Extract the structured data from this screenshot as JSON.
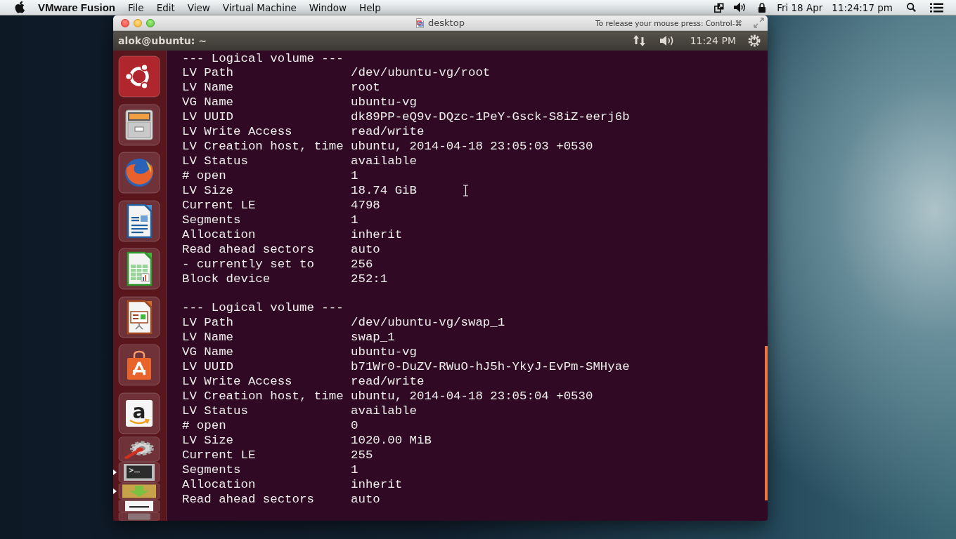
{
  "menu_bar": {
    "app_name": "VMware Fusion",
    "menus": [
      "File",
      "Edit",
      "View",
      "Virtual Machine",
      "Window",
      "Help"
    ],
    "date": "Fri 18 Apr",
    "time": "11:24:17 pm"
  },
  "vm_window": {
    "title": "desktop",
    "mouse_hint": "To release your mouse press: Control-⌘"
  },
  "top_panel": {
    "title": "alok@ubuntu: ~",
    "clock": "11:24 PM"
  },
  "launcher": {
    "items": [
      {
        "kind": "home",
        "running": false,
        "folded": false
      },
      {
        "kind": "files",
        "running": false,
        "folded": false
      },
      {
        "kind": "browser",
        "running": false,
        "folded": false
      },
      {
        "kind": "writer",
        "running": false,
        "folded": false
      },
      {
        "kind": "calc",
        "running": false,
        "folded": false
      },
      {
        "kind": "impress",
        "running": false,
        "folded": false
      },
      {
        "kind": "software",
        "running": false,
        "folded": false
      },
      {
        "kind": "store",
        "glyph": "a",
        "running": false,
        "folded": false
      },
      {
        "kind": "settings",
        "running": false,
        "folded": true
      },
      {
        "kind": "terminal",
        "running": true,
        "folded": true
      },
      {
        "kind": "downloads",
        "running": true,
        "folded": true
      },
      {
        "kind": "document",
        "running": false,
        "folded": true
      },
      {
        "kind": "trash",
        "running": false,
        "folded": true
      }
    ]
  },
  "terminal": {
    "blocks": [
      {
        "header": "--- Logical volume ---",
        "rows": [
          {
            "label": "LV Path",
            "value": "/dev/ubuntu-vg/root"
          },
          {
            "label": "LV Name",
            "value": "root"
          },
          {
            "label": "VG Name",
            "value": "ubuntu-vg"
          },
          {
            "label": "LV UUID",
            "value": "dk89PP-eQ9v-DQzc-1PeY-Gsck-S8iZ-eerj6b"
          },
          {
            "label": "LV Write Access",
            "value": "read/write"
          },
          {
            "label": "LV Creation host, time",
            "value": "ubuntu, 2014-04-18 23:05:03 +0530"
          },
          {
            "label": "LV Status",
            "value": "available"
          },
          {
            "label": "# open",
            "value": "1"
          },
          {
            "label": "LV Size",
            "value": "18.74 GiB"
          },
          {
            "label": "Current LE",
            "value": "4798"
          },
          {
            "label": "Segments",
            "value": "1"
          },
          {
            "label": "Allocation",
            "value": "inherit"
          },
          {
            "label": "Read ahead sectors",
            "value": "auto"
          },
          {
            "label": "- currently set to",
            "value": "256"
          },
          {
            "label": "Block device",
            "value": "252:1"
          }
        ]
      },
      {
        "header": "--- Logical volume ---",
        "rows": [
          {
            "label": "LV Path",
            "value": "/dev/ubuntu-vg/swap_1"
          },
          {
            "label": "LV Name",
            "value": "swap_1"
          },
          {
            "label": "VG Name",
            "value": "ubuntu-vg"
          },
          {
            "label": "LV UUID",
            "value": "b71Wr0-DuZV-RWuO-hJ5h-YkyJ-EvPm-SMHyae"
          },
          {
            "label": "LV Write Access",
            "value": "read/write"
          },
          {
            "label": "LV Creation host, time",
            "value": "ubuntu, 2014-04-18 23:05:04 +0530"
          },
          {
            "label": "LV Status",
            "value": "available"
          },
          {
            "label": "# open",
            "value": "0"
          },
          {
            "label": "LV Size",
            "value": "1020.00 MiB"
          },
          {
            "label": "Current LE",
            "value": "255"
          },
          {
            "label": "Segments",
            "value": "1"
          },
          {
            "label": "Allocation",
            "value": "inherit"
          },
          {
            "label": "Read ahead sectors",
            "value": "auto"
          }
        ]
      }
    ]
  }
}
